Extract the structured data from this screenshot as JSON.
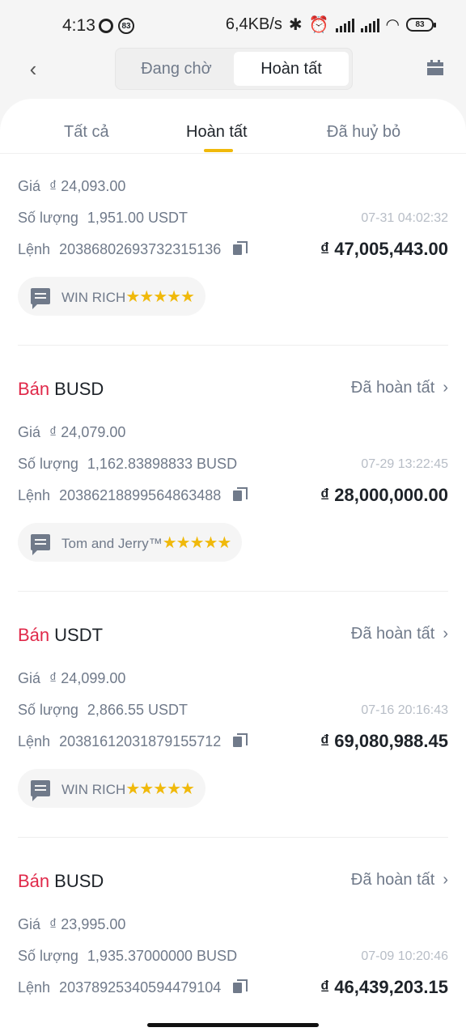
{
  "statusbar": {
    "time": "4:13",
    "notif_badge": "83",
    "net_speed": "6,4KB/s",
    "battery": "83"
  },
  "header": {
    "segments": [
      "Đang chờ",
      "Hoàn tất"
    ],
    "active_segment": "Hoàn tất"
  },
  "tabs": [
    {
      "label": "Tất cả"
    },
    {
      "label": "Hoàn tất"
    },
    {
      "label": "Đã huỷ bỏ"
    }
  ],
  "labels": {
    "price": "Giá",
    "quantity": "Số lượng",
    "order": "Lệnh",
    "currency": "₫",
    "sell": "Bán",
    "status_done": "Đã hoàn tất"
  },
  "orders": [
    {
      "asset": "",
      "price": "24,093.00",
      "quantity": "1,951.00 USDT",
      "order_id": "20386802693732315136",
      "datetime": "07-31 04:02:32",
      "amount": "47,005,443.00",
      "counterparty": "WIN RICH",
      "stars": "★★★★★"
    },
    {
      "asset": "BUSD",
      "price": "24,079.00",
      "quantity": "1,162.83898833 BUSD",
      "order_id": "20386218899564863488",
      "datetime": "07-29 13:22:45",
      "amount": "28,000,000.00",
      "counterparty": "Tom and Jerry™",
      "stars": "★★★★★"
    },
    {
      "asset": "USDT",
      "price": "24,099.00",
      "quantity": "2,866.55 USDT",
      "order_id": "20381612031879155712",
      "datetime": "07-16 20:16:43",
      "amount": "69,080,988.45",
      "counterparty": "WIN RICH",
      "stars": "★★★★★"
    },
    {
      "asset": "BUSD",
      "price": "23,995.00",
      "quantity": "1,935.37000000 BUSD",
      "order_id": "20378925340594479104",
      "datetime": "07-09 10:20:46",
      "amount": "46,439,203.15"
    }
  ],
  "colors": {
    "sell": "#e0294a",
    "accent": "#f0b90b",
    "muted": "#707a8a"
  }
}
